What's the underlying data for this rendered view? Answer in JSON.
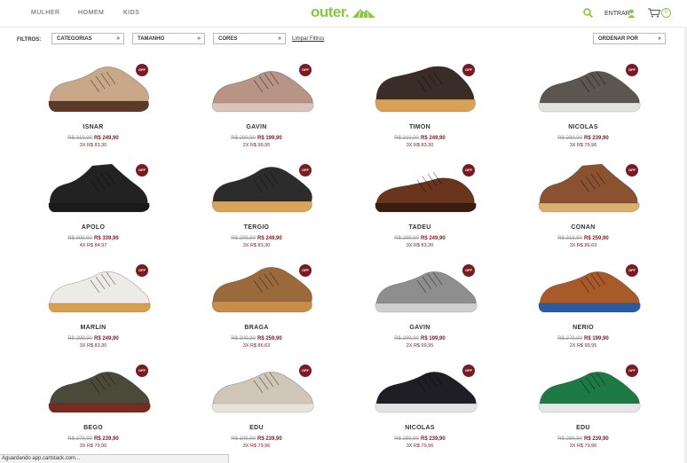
{
  "nav": {
    "women": "MULHER",
    "men": "HOMEM",
    "kids": "KIDS",
    "logo": "outer.",
    "login": "ENTRAR",
    "cart_count": "0"
  },
  "filters": {
    "label": "FILTROS:",
    "categories": "CATEGORIAS",
    "size": "TAMANHO",
    "colors": "CORES",
    "clear": "Limpar Filtros",
    "sort": "ORDENAR POR"
  },
  "badge": "OFF",
  "products": [
    {
      "name": "ISNAR",
      "old": "R$ 319,90",
      "new": "R$ 249,90",
      "inst": "3X R$ 83,30",
      "color": "#c9a88a",
      "sole": "#5b3a2a",
      "style": "sporty"
    },
    {
      "name": "GAVIN",
      "old": "R$ 299,90",
      "new": "R$ 199,90",
      "inst": "2X R$ 99,95",
      "color": "#b79485",
      "sole": "#d8c4b8",
      "style": "sneaker"
    },
    {
      "name": "TIMON",
      "old": "R$ 319,90",
      "new": "R$ 249,90",
      "inst": "3X R$ 83,30",
      "color": "#3a2c27",
      "sole": "#d6a257",
      "style": "strap"
    },
    {
      "name": "NICOLAS",
      "old": "R$ 289,90",
      "new": "R$ 239,90",
      "inst": "3X R$ 79,96",
      "color": "#5c5650",
      "sole": "#e5e2da",
      "style": "sneaker"
    },
    {
      "name": "APOLO",
      "old": "R$ 399,90",
      "new": "R$ 339,90",
      "inst": "4X R$ 84,97",
      "color": "#222222",
      "sole": "#1a1a1a",
      "style": "boot"
    },
    {
      "name": "TERGIO",
      "old": "R$ 299,90",
      "new": "R$ 249,90",
      "inst": "3X R$ 83,30",
      "color": "#2c2c2c",
      "sole": "#d9a35a",
      "style": "sporty"
    },
    {
      "name": "TADEU",
      "old": "R$ 299,90",
      "new": "R$ 249,90",
      "inst": "3X R$ 83,30",
      "color": "#6b341c",
      "sole": "#3a1d10",
      "style": "loafer"
    },
    {
      "name": "CONAN",
      "old": "R$ 319,90",
      "new": "R$ 259,90",
      "inst": "3X R$ 86,63",
      "color": "#8a5230",
      "sole": "#d9b070",
      "style": "boot"
    },
    {
      "name": "MARLIN",
      "old": "R$ 299,90",
      "new": "R$ 249,90",
      "inst": "3X R$ 83,30",
      "color": "#ecebe6",
      "sole": "#d7a050",
      "style": "sneaker"
    },
    {
      "name": "BRAGA",
      "old": "R$ 309,90",
      "new": "R$ 259,90",
      "inst": "3X R$ 86,63",
      "color": "#9a6a3c",
      "sole": "#c98d4a",
      "style": "sporty"
    },
    {
      "name": "GAVIN",
      "old": "R$ 299,90",
      "new": "R$ 199,90",
      "inst": "2X R$ 99,95",
      "color": "#8e8e8e",
      "sole": "#cfcfcf",
      "style": "sneaker"
    },
    {
      "name": "NERIO",
      "old": "R$ 279,90",
      "new": "R$ 199,90",
      "inst": "2X R$ 99,95",
      "color": "#a85a2a",
      "sole": "#2b5c9e",
      "style": "sneaker"
    },
    {
      "name": "BEGO",
      "old": "R$ 279,90",
      "new": "R$ 239,90",
      "inst": "3X R$ 79,96",
      "color": "#4a4a3a",
      "sole": "#7a2a1e",
      "style": "sneaker"
    },
    {
      "name": "EDU",
      "old": "R$ 309,90",
      "new": "R$ 239,90",
      "inst": "3X R$ 79,96",
      "color": "#cfc6b8",
      "sole": "#e8e2d8",
      "style": "sneaker"
    },
    {
      "name": "NICOLAS",
      "old": "R$ 289,90",
      "new": "R$ 239,90",
      "inst": "3X R$ 79,96",
      "color": "#1e1e24",
      "sole": "#e3e3e3",
      "style": "sneaker"
    },
    {
      "name": "EDU",
      "old": "R$ 289,90",
      "new": "R$ 239,90",
      "inst": "3X R$ 79,96",
      "color": "#1e7a45",
      "sole": "#e6e6e6",
      "style": "sneaker"
    }
  ],
  "status": "Aguardando app.cartstack.com..."
}
